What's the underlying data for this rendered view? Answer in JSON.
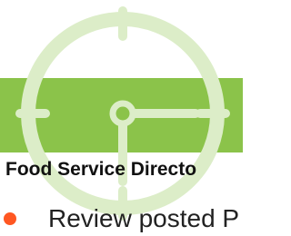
{
  "colors": {
    "band": "#8bc34a",
    "clock": "#dcedc8",
    "bullet": "#ff5722"
  },
  "icons": {
    "background": "clock-icon",
    "bullet": "bullet-dot-icon"
  },
  "heading": {
    "text": "Food Service Directo"
  },
  "list": {
    "item_1": "Review posted P"
  }
}
